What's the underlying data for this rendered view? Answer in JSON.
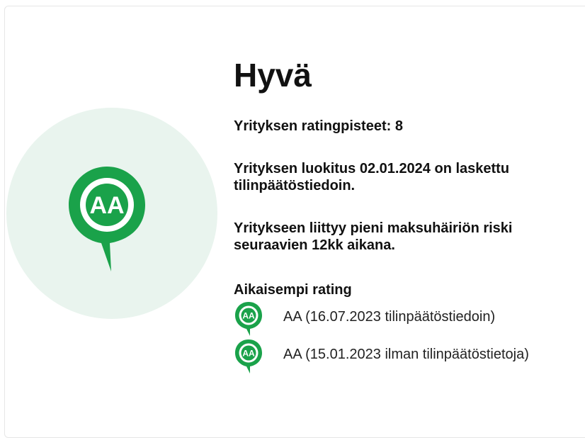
{
  "rating": {
    "grade_code": "AA",
    "title": "Hyvä",
    "score_text": "Yrityksen ratingpisteet: 8",
    "calculation_text": "Yrityksen luokitus 02.01.2024 on laskettu tilinpäätöstiedoin.",
    "risk_text": "Yritykseen liittyy pieni maksuhäiriön riski seuraavien 12kk aikana."
  },
  "previous": {
    "heading": "Aikaisempi rating",
    "items": [
      {
        "badge": "AA",
        "text": "AA (16.07.2023 tilinpäätöstiedoin)"
      },
      {
        "badge": "AA",
        "text": "AA (15.01.2023 ilman tilinpäätöstietoja)"
      }
    ]
  },
  "colors": {
    "accent_green": "#1aa24a",
    "circle_bg": "#e9f4ee"
  },
  "icons": {
    "big_badge": "rating-pin-icon",
    "small_badge": "rating-pin-icon"
  }
}
